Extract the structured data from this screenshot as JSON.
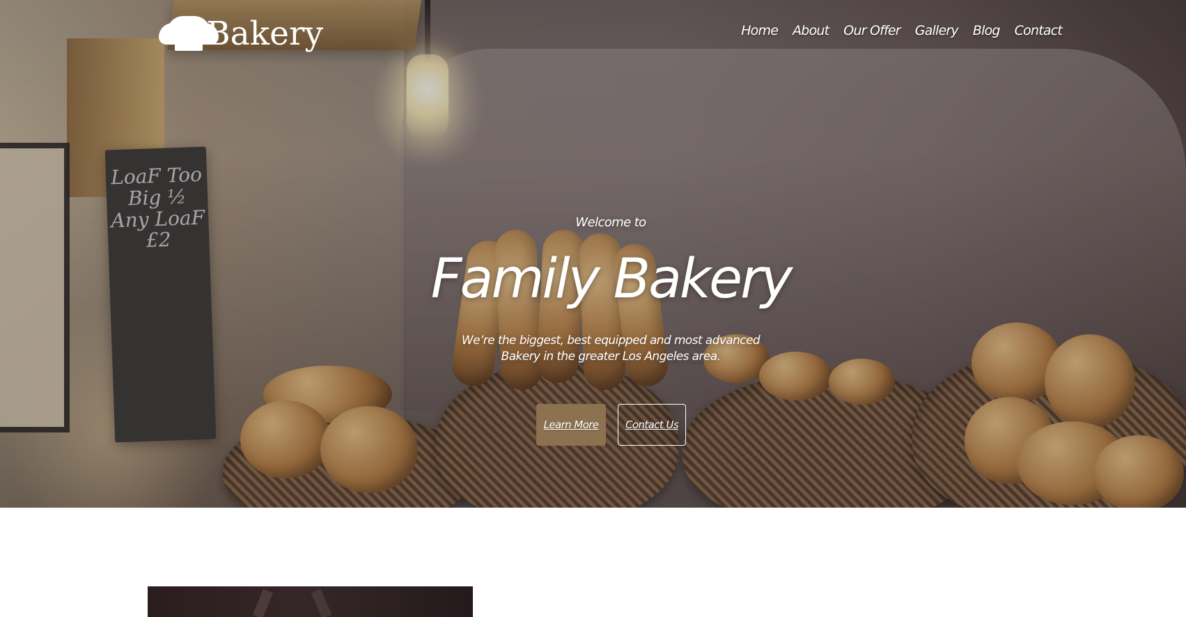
{
  "brand": {
    "name": "Bakery",
    "logo_icon": "chef-hat-icon"
  },
  "navigation": {
    "items": [
      {
        "label": "Home"
      },
      {
        "label": "About"
      },
      {
        "label": "Our Offer"
      },
      {
        "label": "Gallery"
      },
      {
        "label": "Blog"
      },
      {
        "label": "Contact"
      }
    ]
  },
  "hero": {
    "welcome": "Welcome to",
    "title": "Family Bakery",
    "description": "We’re the biggest, best equipped and most advanced Bakery in the greater Los Angeles area.",
    "background": "bakery-bread-baskets-image",
    "chalkboard_text": "LoaF Too Big ½ Any LoaF £2",
    "buttons": {
      "learn_more": "Learn More",
      "contact_us": "Contact Us"
    }
  },
  "colors": {
    "accent": "#8c7250",
    "text_light": "#ffffff",
    "page_background": "#ffffff"
  },
  "next_section": {
    "image": "bakery-interior-image"
  }
}
